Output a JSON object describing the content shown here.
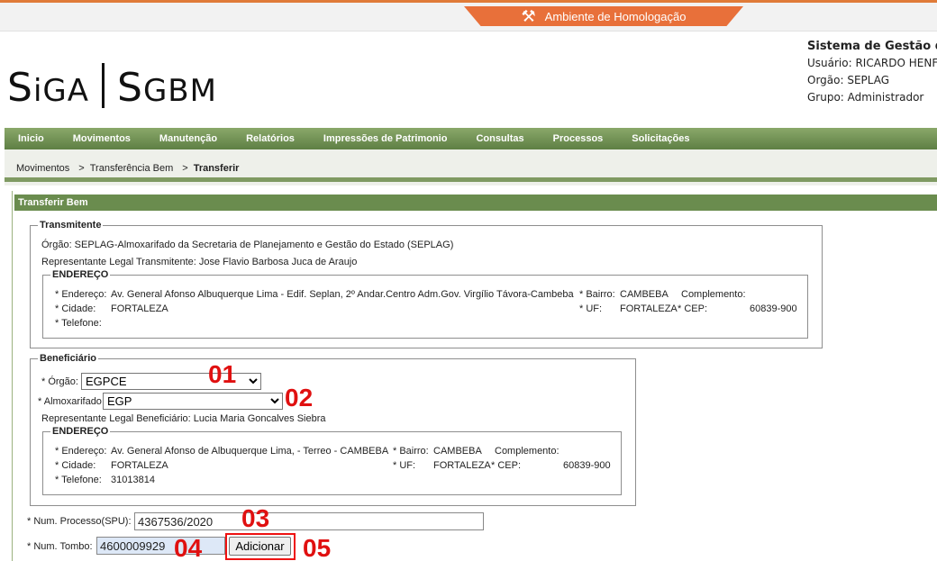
{
  "environment": {
    "label": "Ambiente de Homologação",
    "icon": "tools-icon"
  },
  "logo": {
    "part1_big": "S",
    "part1_small": "iGA",
    "part2_big": "S",
    "part2_small": "GBM"
  },
  "system": {
    "title": "Sistema de Gestão de",
    "usuario": "Usuário: RICARDO HENF",
    "orgao": "Orgão: SEPLAG",
    "grupo": "Grupo: Administrador"
  },
  "menu": [
    "Inicio",
    "Movimentos",
    "Manutenção",
    "Relatórios",
    "Impressões de Patrimonio",
    "Consultas",
    "Processos",
    "Solicitações"
  ],
  "breadcrumb": {
    "level1": "Movimentos",
    "level2": "Transferência Bem",
    "current": "Transferir"
  },
  "panel_title": "Transferir Bem",
  "transmitente": {
    "legend": "Transmitente",
    "orgao": "Órgão:  SEPLAG-Almoxarifado da Secretaria de Planejamento e Gestão do Estado (SEPLAG)",
    "representante": "Representante Legal Transmitente:  Jose Flavio Barbosa Juca de Araujo",
    "endereco": {
      "legend": "ENDEREÇO",
      "endereco_label": "* Endereço:",
      "endereco_value": "Av. General Afonso Albuquerque Lima - Edif. Seplan, 2º Andar.Centro Adm.Gov. Virgílio Távora-Cambeba",
      "bairro_label": "* Bairro:",
      "bairro_value": "CAMBEBA",
      "complemento_label": "Complemento:",
      "cidade_label": "* Cidade:",
      "cidade_value": "FORTALEZA",
      "uf_label": "* UF:",
      "uf_value": "FORTALEZA",
      "cep_label": "* CEP:",
      "cep_value": "60839-900",
      "telefone_label": "* Telefone:",
      "telefone_value": ""
    }
  },
  "beneficiario": {
    "legend": "Beneficiário",
    "orgao_label": "* Órgão:",
    "orgao_value": "EGPCE",
    "almox_label": "* Almoxarifado",
    "almox_value": "EGP",
    "representante": "Representante Legal Beneficiário:  Lucia Maria Goncalves Siebra",
    "endereco": {
      "legend": "ENDEREÇO",
      "endereco_label": "* Endereço:",
      "endereco_value": "Av. General Afonso de Albuquerque Lima, - Terreo - CAMBEBA",
      "bairro_label": "* Bairro:",
      "bairro_value": "CAMBEBA",
      "complemento_label": "Complemento:",
      "cidade_label": "* Cidade:",
      "cidade_value": "FORTALEZA",
      "uf_label": "* UF:",
      "uf_value": "FORTALEZA",
      "cep_label": "* CEP:",
      "cep_value": "60839-900",
      "telefone_label": "* Telefone:",
      "telefone_value": "31013814"
    }
  },
  "processo": {
    "label": "* Num. Processo(SPU):",
    "value": "4367536/2020"
  },
  "tombo": {
    "label": "* Num. Tombo:",
    "value": "4600009929"
  },
  "add_button": "Adicionar",
  "annotations": [
    "01",
    "02",
    "03",
    "04",
    "05"
  ],
  "annotation_color": "#e01010"
}
